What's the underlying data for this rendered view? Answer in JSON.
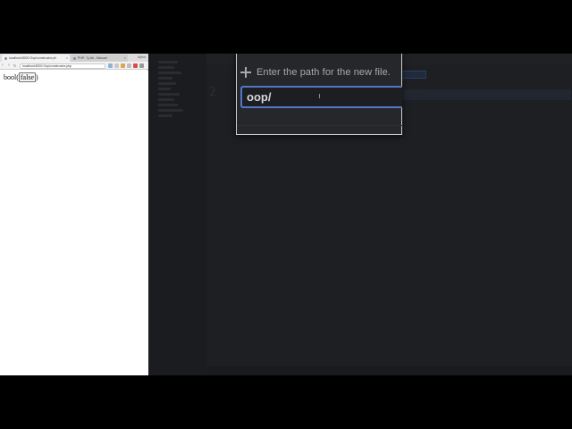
{
  "browser": {
    "tabs": [
      {
        "label": "localhost:8000 Oop/constructor.ph",
        "active": true
      },
      {
        "label": "PHP: ?y Ab - Manual",
        "active": false
      }
    ],
    "profile": "Alpha",
    "address": "localhost:8000 Oop/constructor.php",
    "output_prefix": "bool(",
    "output_value": "false",
    "output_suffix": ")"
  },
  "editor": {
    "line_number": "2",
    "ghost_code": "tr(::"
  },
  "modal": {
    "prompt": "Enter the path for the new file.",
    "path_value": "oop/"
  },
  "colors": {
    "accent": "#5277c4",
    "editor_bg": "#1e1f22",
    "modal_bg": "#26272b"
  }
}
